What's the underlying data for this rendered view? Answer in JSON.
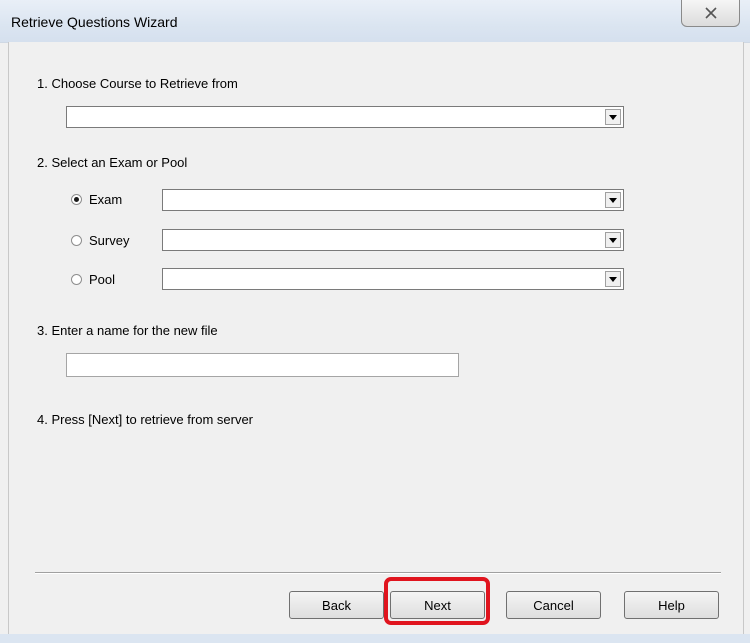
{
  "window": {
    "title": "Retrieve Questions Wizard",
    "close_symbol": "☒"
  },
  "steps": {
    "step1_label": "1.  Choose Course to Retrieve from",
    "step2_label": "2.  Select an Exam or Pool",
    "step3_label": "3.  Enter a name for the new file",
    "step4_label": "4.  Press [Next] to retrieve from server"
  },
  "course_combo": {
    "value": ""
  },
  "source_options": [
    {
      "label": "Exam",
      "selected": true,
      "combo_value": ""
    },
    {
      "label": "Survey",
      "selected": false,
      "combo_value": ""
    },
    {
      "label": "Pool",
      "selected": false,
      "combo_value": ""
    }
  ],
  "filename_input": {
    "value": "",
    "placeholder": ""
  },
  "buttons": {
    "back": "Back",
    "next": "Next",
    "cancel": "Cancel",
    "help": "Help"
  },
  "colors": {
    "highlight": "#e0141e",
    "titlebar": "#dbe5f1",
    "dialog_bg": "#f0f0f0"
  }
}
